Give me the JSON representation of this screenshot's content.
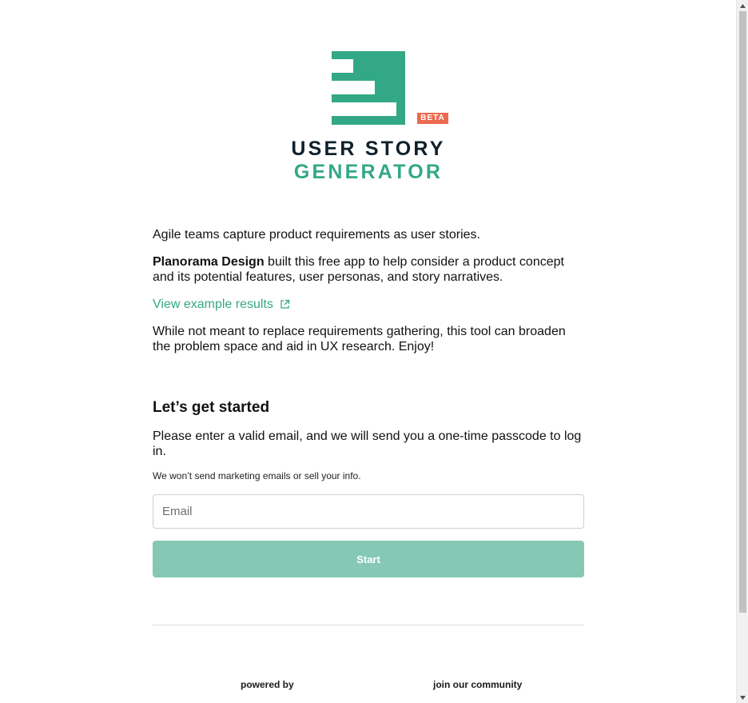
{
  "logo": {
    "badge": "BETA",
    "line1": "USER STORY",
    "line2": "GENERATOR",
    "colors": {
      "mark": "#33a887",
      "badge": "#ec6a4f",
      "line1": "#10202a",
      "line2": "#33a887"
    }
  },
  "intro": {
    "p1": "Agile teams capture product requirements as user stories.",
    "brand": "Planorama Design",
    "p2_rest": " built this free app to help consider a product concept and its potential features, user personas, and story narratives.",
    "example_link": "View example results",
    "p4": "While not meant to replace requirements gathering, this tool can broaden the problem space and aid in UX research. Enjoy!"
  },
  "signup": {
    "heading": "Let’s get started",
    "instructions": "Please enter a valid email, and we will send you a one-time passcode to log in.",
    "note": "We won’t send marketing emails or sell your info.",
    "email_placeholder": "Email",
    "email_value": "",
    "start_label": "Start"
  },
  "footer": {
    "powered_by": "powered by",
    "community": "join our community"
  },
  "icons": {
    "external_link": "external-link-icon",
    "scroll_up": "scroll-up-arrow-icon",
    "scroll_down": "scroll-down-arrow-icon"
  },
  "colors": {
    "accent": "#33a887",
    "button_disabled": "#85c9b4"
  }
}
